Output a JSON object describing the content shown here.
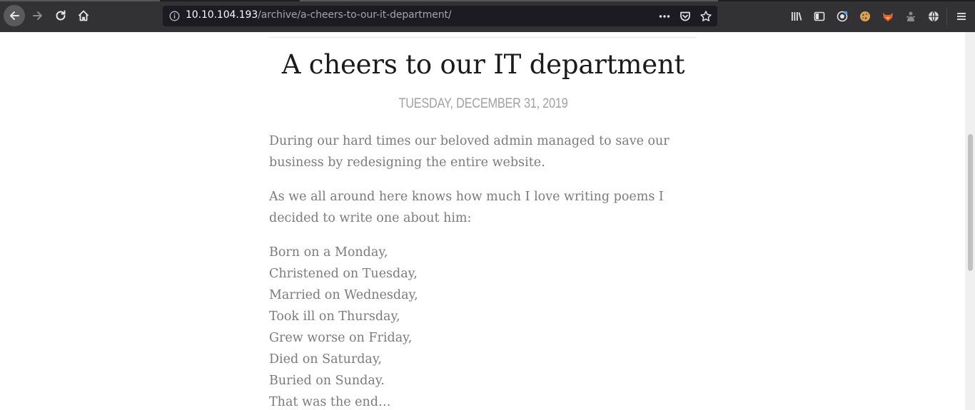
{
  "browser": {
    "url_host": "10.10.104.193",
    "url_path": "/archive/a-cheers-to-our-it-department/",
    "icons": {
      "back": "arrow-left-icon",
      "forward": "arrow-right-icon",
      "reload": "reload-icon",
      "home": "home-icon",
      "info": "info-icon",
      "page_actions": "more-horizontal-icon",
      "pocket": "pocket-icon",
      "bookmark": "star-icon",
      "library": "library-icon",
      "sidebar": "sidebar-icon",
      "account": "account-icon",
      "cookie": "cookie-extension-icon",
      "fox": "fox-extension-icon",
      "puzzle": "extension-icon",
      "globe": "globe-icon",
      "menu": "hamburger-menu-icon"
    }
  },
  "post": {
    "title": "A cheers to our IT department",
    "date": "TUESDAY, DECEMBER 31, 2019",
    "paragraph1": "During our hard times our beloved admin managed to save our business by redesigning the entire website.",
    "paragraph2": "As we all around here knows how much I love writing poems I decided to write one about him:",
    "poem": [
      "Born on a Monday,",
      "Christened on Tuesday,",
      "Married on Wednesday,",
      "Took ill on Thursday,",
      "Grew worse on Friday,",
      "Died on Saturday,",
      "Buried on Sunday.",
      "That was the end…"
    ]
  },
  "colors": {
    "toolbar_bg": "#323234",
    "urlbar_bg": "#1c1b22",
    "title_text": "#1b1b1b",
    "body_text": "#7b7b7b",
    "date_text": "#a1a1a1"
  }
}
